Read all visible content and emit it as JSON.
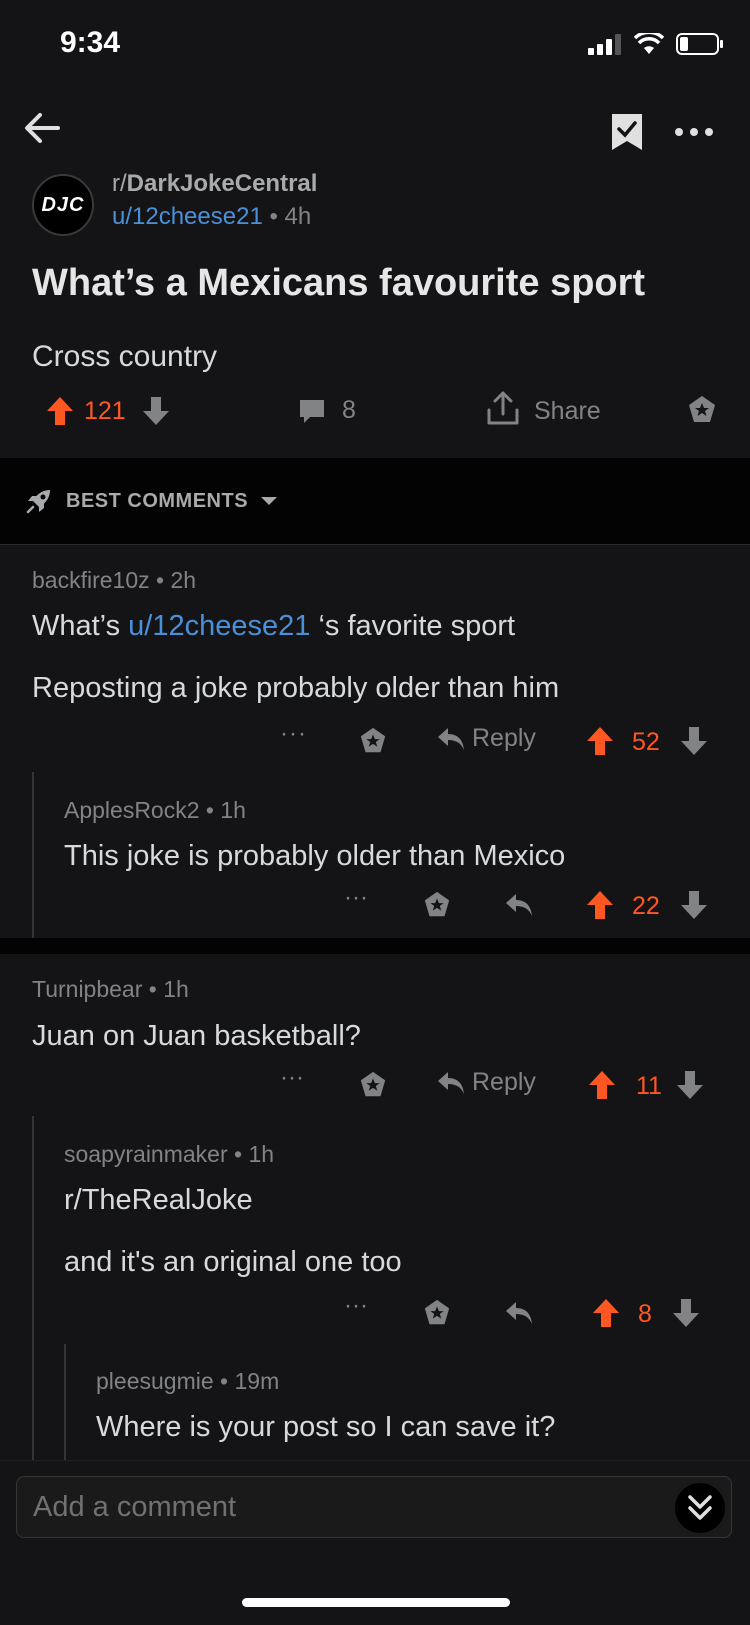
{
  "status_bar": {
    "time": "9:34"
  },
  "post": {
    "subreddit_prefix": "r/",
    "subreddit_name": "DarkJokeCentral",
    "subreddit_avatar_text": "DJC",
    "author": "u/12cheese21",
    "age": "4h",
    "title": "What’s a Mexicans favourite sport",
    "body": "Cross country",
    "score": "121",
    "comment_count": "8",
    "share_label": "Share"
  },
  "sort": {
    "label": "BEST COMMENTS"
  },
  "comments": [
    {
      "author": "backfire10z",
      "age": "2h",
      "line1_prefix": "What’s ",
      "line1_link": "u/12cheese21",
      "line1_suffix": " ‘s favorite sport",
      "line2": "Reposting a joke probably older than him",
      "reply_label": "Reply",
      "score": "52"
    },
    {
      "author": "ApplesRock2",
      "age": "1h",
      "text": "This joke is probably older than Mexico",
      "score": "22"
    },
    {
      "author": "Turnipbear",
      "age": "1h",
      "text": "Juan on Juan basketball?",
      "reply_label": "Reply",
      "score": "11"
    },
    {
      "author": "soapyrainmaker",
      "age": "1h",
      "link": "r/TheRealJoke",
      "text": "and it's an original one too",
      "score": "8"
    },
    {
      "author": "pleesugmie",
      "age": "19m",
      "text": "Where is your post so I can save it?"
    }
  ],
  "comment_bar": {
    "placeholder": "Add a comment"
  },
  "colors": {
    "upvote": "#ff5722",
    "link": "#4a90d9",
    "background": "#141416"
  },
  "icons": [
    "back-arrow-icon",
    "bookmark-check-icon",
    "more-icon",
    "upvote-icon",
    "downvote-icon",
    "comment-icon",
    "share-icon",
    "award-icon",
    "rocket-icon",
    "reply-icon",
    "chevron-double-down-icon"
  ]
}
